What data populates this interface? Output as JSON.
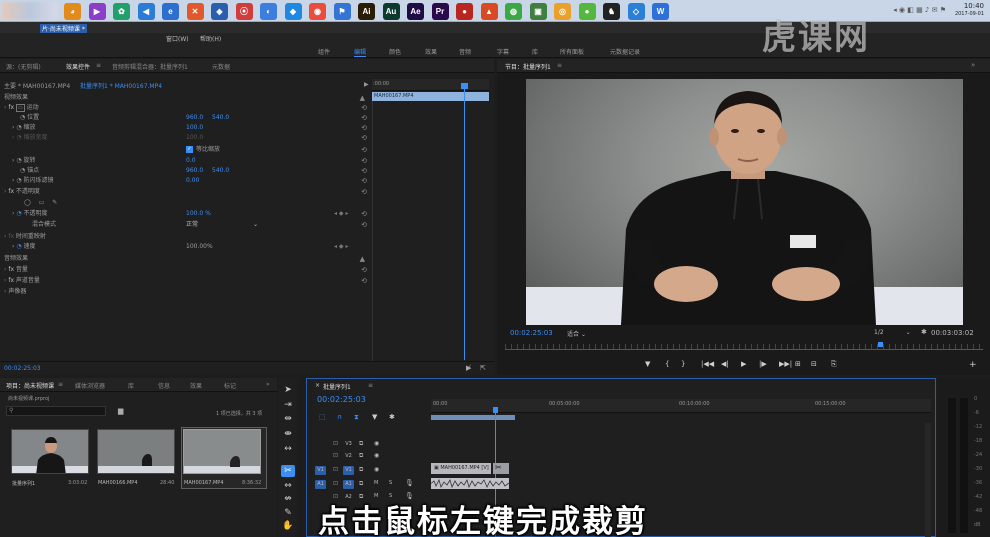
{
  "taskbar": {
    "icons": [
      {
        "label": "◕",
        "color": "#e38a1c"
      },
      {
        "label": "▶",
        "color": "#8b3fc9"
      },
      {
        "label": "✿",
        "color": "#22a06b"
      },
      {
        "label": "◀",
        "color": "#2a7cd4"
      },
      {
        "label": "e",
        "color": "#2c6fcf"
      },
      {
        "label": "✕",
        "color": "#e2582c"
      },
      {
        "label": "◈",
        "color": "#2b5fae"
      },
      {
        "label": "⦿",
        "color": "#d33c3c"
      },
      {
        "label": "◐",
        "color": "#3c7de0"
      },
      {
        "label": "◆",
        "color": "#1f88e0"
      },
      {
        "label": "◉",
        "color": "#ea4d3c"
      },
      {
        "label": "⚑",
        "color": "#3474d4"
      },
      {
        "label": "Ai",
        "color": "#2a1d06"
      },
      {
        "label": "Au",
        "color": "#0c3b2e"
      },
      {
        "label": "Ae",
        "color": "#1f0c47"
      },
      {
        "label": "Pr",
        "color": "#2a0a4a"
      },
      {
        "label": "●",
        "color": "#b8261f"
      },
      {
        "label": "▲",
        "color": "#d84a23"
      },
      {
        "label": "◍",
        "color": "#3aa845"
      },
      {
        "label": "▣",
        "color": "#3f7f3f"
      },
      {
        "label": "◎",
        "color": "#e9a12b"
      },
      {
        "label": "●",
        "color": "#53b83d"
      },
      {
        "label": "♞",
        "color": "#222222"
      },
      {
        "label": "◇",
        "color": "#2b7fd6"
      },
      {
        "label": "W",
        "color": "#2e6fd8"
      }
    ],
    "clock_time": "10:40",
    "clock_date": "2017-09-01"
  },
  "titlebar": {
    "title": "片·尚未视频课 *"
  },
  "menubar": {
    "items": [
      "窗口(W)",
      "帮助(H)"
    ]
  },
  "workspaces": [
    "组件",
    "编辑",
    "颜色",
    "效果",
    "音频",
    "字幕",
    "库",
    "所有面板",
    "元数据记录"
  ],
  "active_workspace": "编辑",
  "effect_panel": {
    "tabs": [
      "源：(无剪辑)",
      "效果控件",
      "音频剪辑混合器：批量序列1",
      "元数据"
    ],
    "active_tab": "效果控件",
    "clip_header": "主要 * MAH00167.MP4",
    "clip_link": "批量序列1 * MAH00167.MP4",
    "time_ruler": ":00:00",
    "clip_bar": "MAH00167.MP4",
    "video_effects_label": "视频效果",
    "motion": "运动",
    "position_label": "位置",
    "position_x": "960.0",
    "position_y": "540.0",
    "scale_label": "缩放",
    "scale_value": "100.0",
    "scale_width_label": "缩放宽度",
    "scale_width_value": "100.0",
    "uniform_scale": "等比缩放",
    "rotation_label": "旋转",
    "rotation_value": "0.0",
    "anchor_label": "锚点",
    "anchor_x": "960.0",
    "anchor_y": "540.0",
    "flicker_label": "防闪烁滤镜",
    "flicker_value": "0.00",
    "opacity_group": "不透明度",
    "opacity_label": "不透明度",
    "opacity_value": "100.0 %",
    "blend_label": "混合模式",
    "blend_value": "正常",
    "time_remap_group": "时间重映射",
    "speed_label": "速度",
    "speed_value": "100.00%",
    "audio_effects_label": "音频效果",
    "volume": "音量",
    "channel_volume": "声道音量",
    "panner": "声像器",
    "timecode": "00:02:25:03"
  },
  "program_monitor": {
    "title": "节目：批量序列1",
    "timecode": "00:02:25:03",
    "fit": "适合",
    "resolution": "1/2",
    "duration": "00:03:03:02"
  },
  "project_panel": {
    "tabs": [
      "项目：尚未视频课",
      "媒体浏览器",
      "库",
      "信息",
      "效果",
      "标记"
    ],
    "project_file": "尚未视频课.prproj",
    "selection_info": "1 项已选择，共 3 项",
    "items": [
      {
        "name": "批量序列1",
        "duration": "3:03:02"
      },
      {
        "name": "MAH00166.MP4",
        "duration": "28:40"
      },
      {
        "name": "MAH00167.MP4",
        "duration": "8:36:32"
      }
    ]
  },
  "timeline": {
    "tab": "批量序列1",
    "timecode": "00:02:25:03",
    "ruler_labels": [
      "00:00",
      "00:05:00:00",
      "00:10:00:00",
      "00:15:00:00"
    ],
    "tracks": [
      {
        "name": "V3",
        "src": ""
      },
      {
        "name": "V2",
        "src": ""
      },
      {
        "name": "V1",
        "src": "V1"
      },
      {
        "name": "A1",
        "src": "A1"
      },
      {
        "name": "A2",
        "src": ""
      }
    ],
    "clip_label": "MAH00167.MP4 [V]",
    "track_buttons": {
      "mute": "M",
      "solo": "S"
    }
  },
  "audio_meter": {
    "ticks": [
      "0",
      "-6",
      "-12",
      "-18",
      "-24",
      "-30",
      "-36",
      "-42",
      "-48",
      "dB"
    ]
  },
  "subtitle": "点击鼠标左键完成裁剪",
  "watermark": "虎课网",
  "monitor_controls": [
    "▼",
    "{",
    "}",
    "|◀◀",
    "◀|",
    "▶",
    "|▶",
    "▶▶|",
    "⊞",
    "⊟",
    "⎘"
  ]
}
